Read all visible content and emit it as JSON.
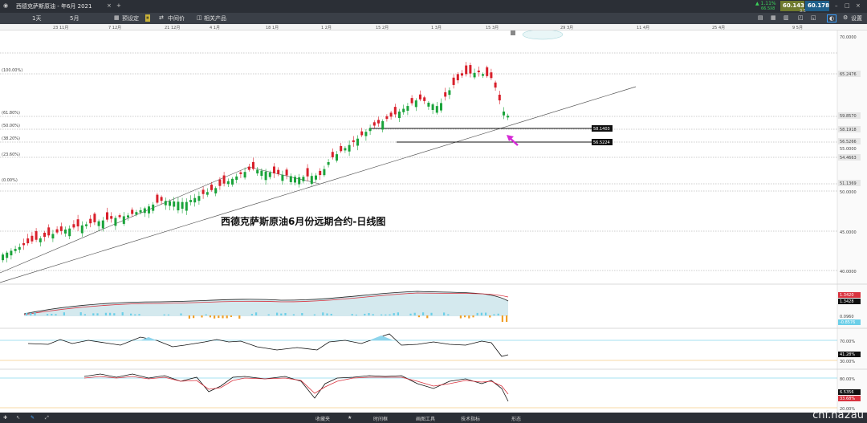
{
  "window": {
    "title": "西德克萨斯原油 - 年6月 2021",
    "add_tab": "+",
    "change_pct": "▲ 1.11%",
    "change_abs": "66.5ƛ8",
    "bid": "60.143",
    "spread": "3.5",
    "ask": "60.178",
    "colors": {
      "bid_bg": "#6f7a2e",
      "ask_bg": "#1f5f8a",
      "bull": "#1aa33a",
      "bear": "#d81f2a"
    }
  },
  "toolbar": {
    "timeframe": "1天",
    "range": "5月",
    "preset": "预设定",
    "mid_price": "中间价",
    "related": "相关产品",
    "settings": "设置"
  },
  "axis_top": {
    "labels": [
      "23 11月",
      "7 12月",
      "21 12月",
      "4 1月",
      "18 1月",
      "1 2月",
      "15 2月",
      "1 3月",
      "15 3月",
      "29 3月",
      "11 4月",
      "25 4月",
      "9 5月"
    ]
  },
  "price_axis": {
    "labels": [
      "70.0000",
      "65.2476",
      "59.8570",
      "58.1918",
      "56.5266",
      "54.4663",
      "51.1369",
      "50.0000",
      "45.0000",
      "40.0000"
    ],
    "minor_labels": [
      "55.0000",
      "50.0000"
    ]
  },
  "fibonacci": {
    "levels": [
      "(100.00%)",
      "(61.80%)",
      "(50.00%)",
      "(38.20%)",
      "(23.60%)",
      "(0.00%)"
    ]
  },
  "tags": {
    "support_1": "58.1403",
    "support_2": "56.5224"
  },
  "caption": "西德克萨斯原油6月份远期合约-日线图",
  "indicators": {
    "macd_values": [
      "1.3420",
      "1.3428"
    ],
    "macd_zero": "0.0960",
    "macd_low": "-0.8576",
    "rsi_value": "41.28%",
    "rsi_70": "70.00%",
    "rsi_30": "30.00%",
    "stoch_value": "6.5356",
    "stoch_level": "33.68%",
    "stoch_80": "80.00%",
    "stoch_20": "20.00%"
  },
  "bottombar": {
    "favorites": "收藏夹",
    "timeframe": "时间框",
    "drawing": "画图工具",
    "technical": "技术指标",
    "shapes": "形态"
  },
  "watermark": "cnf.na2au"
}
